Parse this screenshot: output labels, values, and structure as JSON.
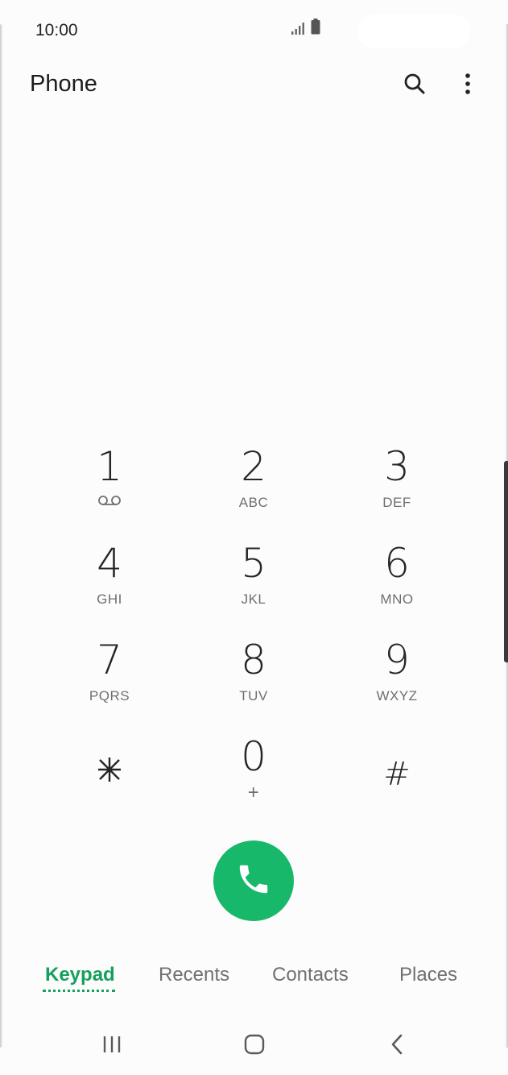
{
  "status_bar": {
    "time": "10:00",
    "icons": [
      "signal-icon",
      "battery-icon"
    ]
  },
  "header": {
    "title": "Phone",
    "actions": [
      "search-icon",
      "more-options-icon"
    ]
  },
  "keypad": {
    "keys": [
      {
        "digit": "1",
        "sub": "",
        "sub_icon": "voicemail-icon"
      },
      {
        "digit": "2",
        "sub": "ABC"
      },
      {
        "digit": "3",
        "sub": "DEF"
      },
      {
        "digit": "4",
        "sub": "GHI"
      },
      {
        "digit": "5",
        "sub": "JKL"
      },
      {
        "digit": "6",
        "sub": "MNO"
      },
      {
        "digit": "7",
        "sub": "PQRS"
      },
      {
        "digit": "8",
        "sub": "TUV"
      },
      {
        "digit": "9",
        "sub": "WXYZ"
      },
      {
        "digit": "*",
        "sub": ""
      },
      {
        "digit": "0",
        "sub": "+"
      },
      {
        "digit": "#",
        "sub": ""
      }
    ]
  },
  "call_button": {
    "icon": "phone-call-icon",
    "color": "#17b86a"
  },
  "tabs": [
    {
      "label": "Keypad",
      "active": true
    },
    {
      "label": "Recents",
      "active": false
    },
    {
      "label": "Contacts",
      "active": false
    },
    {
      "label": "Places",
      "active": false
    }
  ],
  "accent_color": "#15a05c",
  "nav_bar": [
    "recent-apps-icon",
    "home-icon",
    "back-icon"
  ]
}
